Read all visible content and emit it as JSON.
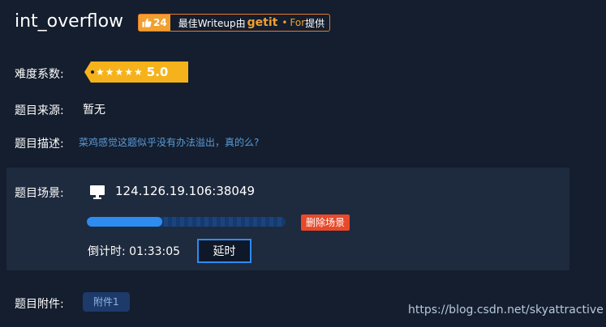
{
  "challenge": {
    "title": "int_overflow"
  },
  "writeup_badge": {
    "likes": "24",
    "prefix": "最佳Writeup由",
    "user": "getit",
    "dot": "•",
    "for_text": "For",
    "suffix": "提供",
    "icon": "thumbs-up-icon"
  },
  "difficulty": {
    "label": "难度系数:",
    "stars": "★★★★★",
    "score": "5.0"
  },
  "source": {
    "label": "题目来源:",
    "value": "暂无"
  },
  "description": {
    "label": "题目描述:",
    "value": "菜鸡感觉这题似乎没有办法溢出，真的么?"
  },
  "scene": {
    "label": "题目场景:",
    "icon": "monitor-icon",
    "address": "124.126.19.106:38049",
    "progress_fraction": 0.38,
    "delete_label": "删除场景",
    "countdown_label": "倒计时:",
    "countdown_value": "01:33:05",
    "extend_label": "延时"
  },
  "attachments": {
    "label": "题目附件:",
    "items": [
      "附件1"
    ]
  },
  "watermark": "https://blog.csdn.net/skyattractive",
  "colors": {
    "background": "#141e2e",
    "panel": "#1e2a3d",
    "accent_orange": "#f0a030",
    "difficulty_tag": "#f5b21b",
    "progress_blue": "#2d8cf0",
    "delete_red": "#e8492a",
    "description_blue": "#5b9bd8"
  }
}
